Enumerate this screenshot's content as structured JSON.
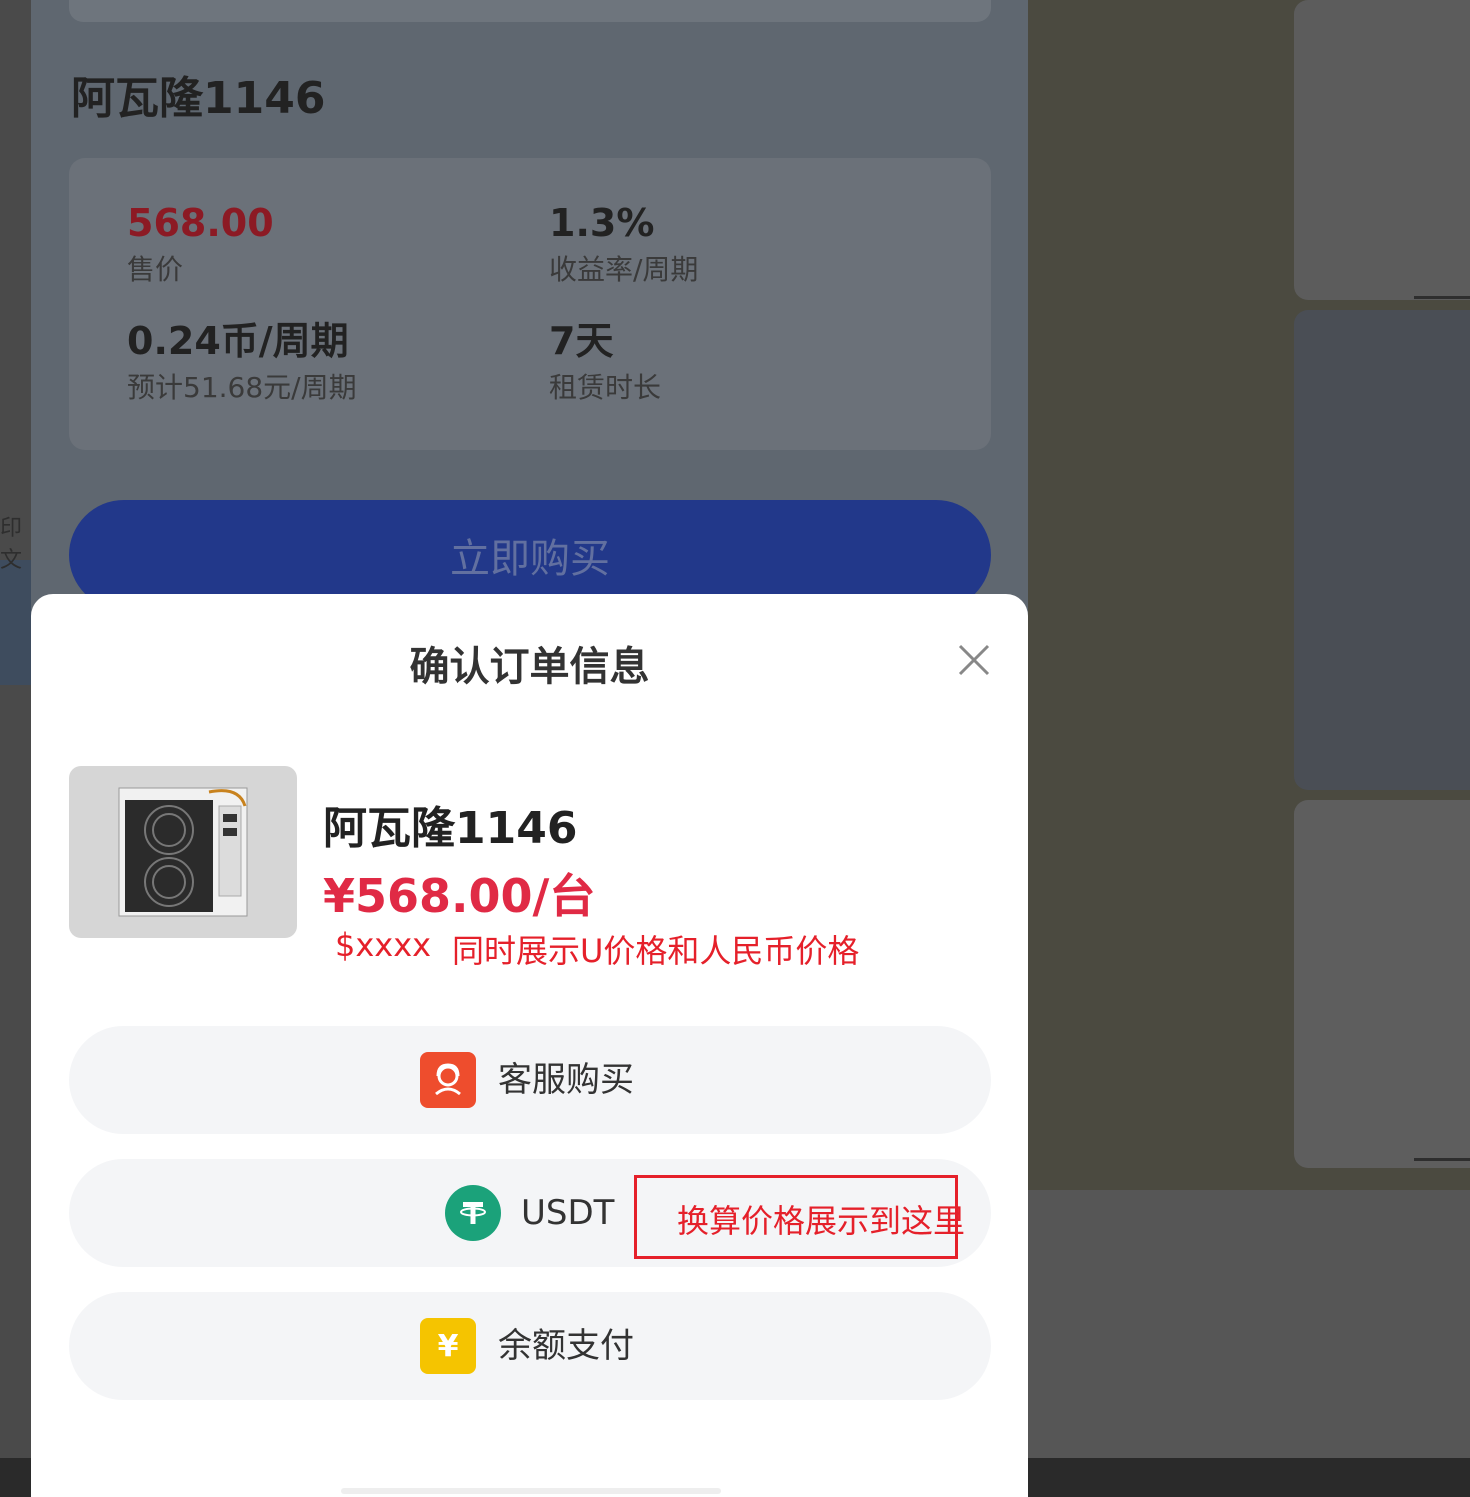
{
  "background_page": {
    "product_title": "阿瓦隆1146",
    "stats": [
      {
        "value": "568.00",
        "label": "售价",
        "highlight": true
      },
      {
        "value": "1.3%",
        "label": "收益率/周期",
        "highlight": false
      },
      {
        "value": "0.24币/周期",
        "label": "预计51.68元/周期",
        "highlight": false
      },
      {
        "value": "7天",
        "label": "租赁时长",
        "highlight": false
      }
    ],
    "buy_button_label": "立即购买",
    "left_edge_text": "印文"
  },
  "modal": {
    "title": "确认订单信息",
    "close_icon": "close-icon",
    "product": {
      "image_icon": "miner-device-image",
      "name": "阿瓦隆1146",
      "price": "¥568.00/台"
    },
    "annotation_usd": "$xxxx",
    "annotation_note": "同时展示U价格和人民币价格",
    "payment_options": [
      {
        "label": "客服购买",
        "icon": "customer-service-icon",
        "icon_color": "#ee4d2d"
      },
      {
        "label": "USDT",
        "icon": "tether-icon",
        "icon_color": "#1ba27a"
      },
      {
        "label": "余额支付",
        "icon": "yuan-balance-icon",
        "icon_color": "#f5c400"
      }
    ],
    "usdt_annotation": "换算价格展示到这里"
  },
  "colors": {
    "accent_red": "#e02a45",
    "annotation_red": "#e5202a",
    "buy_blue": "#2b4fd8"
  }
}
